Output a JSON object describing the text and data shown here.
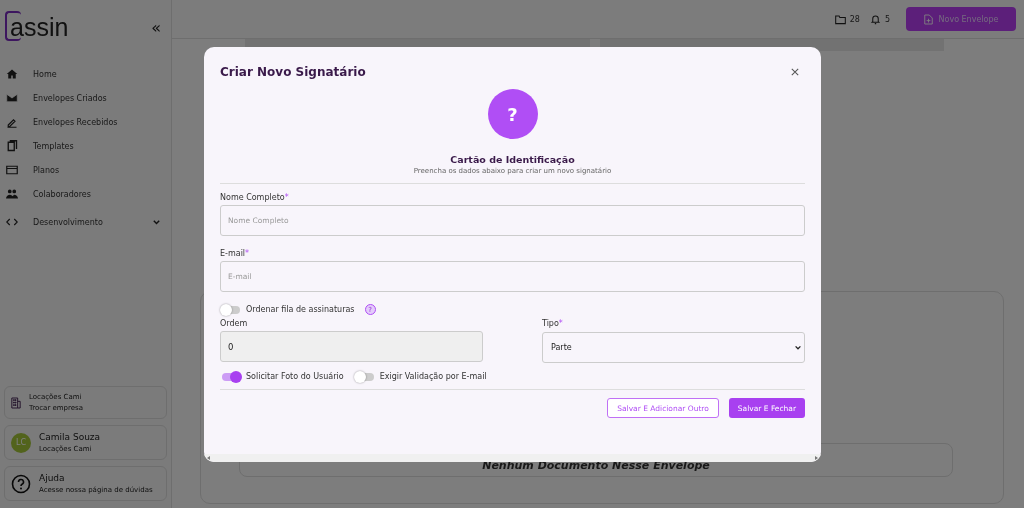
{
  "sidebar": {
    "logo": "assin",
    "collapse": "«",
    "items": [
      {
        "label": "Home"
      },
      {
        "label": "Envelopes Criados"
      },
      {
        "label": "Envelopes Recebidos"
      },
      {
        "label": "Templates"
      },
      {
        "label": "Planos"
      },
      {
        "label": "Colaboradores"
      },
      {
        "label": "Desenvolvimento",
        "expandable": true
      }
    ],
    "company": {
      "name": "Locações Cami",
      "action": "Trocar empresa"
    },
    "user": {
      "initials": "LC",
      "name": "Camila Souza",
      "company": "Locações Cami"
    },
    "help": {
      "title": "Ajuda",
      "text": "Acesse nossa página de dúvidas"
    }
  },
  "topbar": {
    "folders": "28",
    "notifications": "5",
    "new_button": "Novo Envelope"
  },
  "main": {
    "empty_text": "Nenhum Documento Nesse Envelope"
  },
  "modal": {
    "title": "Criar Novo Signatário",
    "avatar": "?",
    "card_title": "Cartão de Identificação",
    "card_subtitle": "Preencha os dados abaixo para criar um novo signatário",
    "name_field": {
      "label": "Nome Completo",
      "required_mark": "*",
      "placeholder": "Nome Completo"
    },
    "email_field": {
      "label": "E-mail",
      "required_mark": "*",
      "placeholder": "E-mail"
    },
    "order_toggle": {
      "label": "Ordenar fila de assinaturas",
      "on": false,
      "help": "?"
    },
    "order_field": {
      "label": "Ordem",
      "value": "0",
      "disabled": true
    },
    "type_field": {
      "label": "Tipo",
      "required_mark": "*",
      "value": "Parte"
    },
    "toggles": [
      {
        "label": "Solicitar Foto do Usuário",
        "on": true
      },
      {
        "label": "Exigir Validação por E-mail",
        "on": false
      }
    ],
    "buttons": [
      {
        "label": "Salvar E Adicionar Outro",
        "kind": "outline"
      },
      {
        "label": "Salvar E Fechar",
        "kind": "primary"
      }
    ]
  }
}
